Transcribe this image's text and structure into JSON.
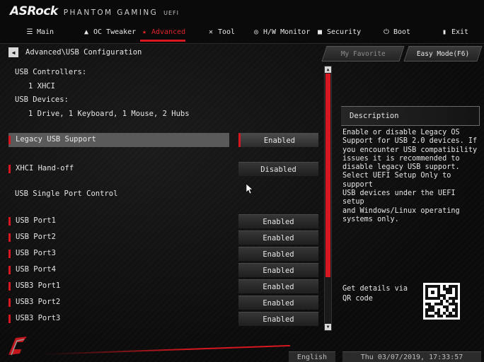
{
  "brand": {
    "logo": "ASRock",
    "subtitle": "PHANTOM GAMING",
    "uefi": "UEFI"
  },
  "tabs": [
    {
      "label": "Main",
      "icon": "list-icon"
    },
    {
      "label": "OC Tweaker",
      "icon": "rocket-icon"
    },
    {
      "label": "Advanced",
      "icon": "star-icon",
      "active": true
    },
    {
      "label": "Tool",
      "icon": "tools-icon"
    },
    {
      "label": "H/W Monitor",
      "icon": "monitor-icon"
    },
    {
      "label": "Security",
      "icon": "shield-icon"
    },
    {
      "label": "Boot",
      "icon": "power-icon"
    },
    {
      "label": "Exit",
      "icon": "exit-icon"
    }
  ],
  "breadcrumb": "Advanced\\USB Configuration",
  "buttons": {
    "favorite": "My Favorite",
    "easy_mode": "Easy Mode(F6)"
  },
  "info": {
    "controllers_label": "USB Controllers:",
    "controllers_value": "1 XHCI",
    "devices_label": "USB Devices:",
    "devices_value": "1 Drive, 1 Keyboard, 1 Mouse, 2 Hubs"
  },
  "settings": [
    {
      "label": "Legacy USB Support",
      "value": "Enabled"
    },
    {
      "label": "XHCI Hand-off",
      "value": "Disabled"
    }
  ],
  "section_label": "USB Single Port Control",
  "ports": [
    {
      "label": "USB Port1",
      "value": "Enabled"
    },
    {
      "label": "USB Port2",
      "value": "Enabled"
    },
    {
      "label": "USB Port3",
      "value": "Enabled"
    },
    {
      "label": "USB Port4",
      "value": "Enabled"
    },
    {
      "label": "USB3 Port1",
      "value": "Enabled"
    },
    {
      "label": "USB3 Port2",
      "value": "Enabled"
    },
    {
      "label": "USB3 Port3",
      "value": "Enabled"
    }
  ],
  "description": {
    "title": "Description",
    "text": "Enable or disable Legacy OS\nSupport for USB 2.0 devices. If\nyou encounter USB compatibility\nissues it is recommended to\ndisable legacy USB support.\nSelect UEFI Setup Only to support\nUSB devices under the UEFI setup\nand Windows/Linux operating\nsystems only."
  },
  "qr_text": "Get details via QR code",
  "footer": {
    "language": "English",
    "datetime": "Thu 03/07/2019, 17:33:57"
  },
  "colors": {
    "accent": "#d6171f",
    "background": "#0d0d0d",
    "text": "#e6e6e6"
  }
}
